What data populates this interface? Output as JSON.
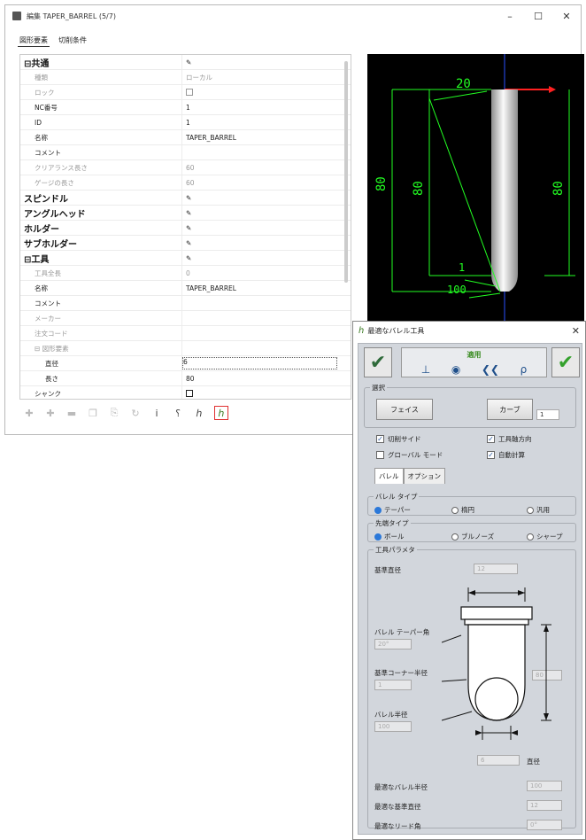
{
  "window": {
    "title": "編集 TAPER_BARREL (5/7)",
    "btn_min": "–",
    "btn_max": "☐",
    "btn_close": "✕"
  },
  "tabs": [
    "図形要素",
    "切削条件"
  ],
  "grid": {
    "rows": [
      {
        "key": "⊟共通",
        "val": "✎",
        "kind": "h"
      },
      {
        "key": "種類",
        "val": "ローカル",
        "kind": "sub"
      },
      {
        "key": "ロック",
        "val": "",
        "kind": "sub",
        "check": true
      },
      {
        "key": "NC番号",
        "val": "1",
        "kind": "dk"
      },
      {
        "key": "ID",
        "val": "1",
        "kind": "dk"
      },
      {
        "key": "名称",
        "val": "TAPER_BARREL",
        "kind": "dk"
      },
      {
        "key": "コメント",
        "val": "",
        "kind": "dk"
      },
      {
        "key": "クリアランス長さ",
        "val": "60",
        "kind": "sub"
      },
      {
        "key": "ゲージの長さ",
        "val": "60",
        "kind": "sub"
      },
      {
        "key": "スピンドル",
        "val": "✎",
        "kind": "h"
      },
      {
        "key": "アングルヘッド",
        "val": "✎",
        "kind": "h"
      },
      {
        "key": "ホルダー",
        "val": "✎",
        "kind": "h"
      },
      {
        "key": "サブホルダー",
        "val": "✎",
        "kind": "h"
      },
      {
        "key": "⊟工具",
        "val": "✎",
        "kind": "h"
      },
      {
        "key": "工具全長",
        "val": "0",
        "kind": "sub"
      },
      {
        "key": "名称",
        "val": "TAPER_BARREL",
        "kind": "dk"
      },
      {
        "key": "コメント",
        "val": "",
        "kind": "dk"
      },
      {
        "key": "メーカー",
        "val": "",
        "kind": "sub"
      },
      {
        "key": "注文コード",
        "val": "",
        "kind": "sub"
      },
      {
        "key": "⊟ 図形要素",
        "val": "",
        "kind": "sub"
      },
      {
        "key": "直径",
        "val": "6",
        "kind": "dk",
        "indent": true,
        "selected": true
      },
      {
        "key": "長さ",
        "val": "80",
        "kind": "dk",
        "indent": true
      },
      {
        "key": "シャンク",
        "val": "",
        "kind": "dk",
        "check": true
      }
    ]
  },
  "preview": {
    "dim_top": "20",
    "dim_left": "80",
    "dim_mid": "80",
    "dim_right": "80",
    "dim_1": "1",
    "dim_100": "100",
    "shank_color": "#e8e8e8",
    "dim_color": "#22ff22",
    "axis_x_color": "#ff2020",
    "axis_y_color": "#2a50ff"
  },
  "dialog": {
    "title": "最適なバレル工具",
    "apply_label": "適用",
    "select_group": "選択",
    "face_label": "フェイス",
    "curve_label": "カーブ",
    "curve_count": "1",
    "cb_cut_side": "切削サイド",
    "cb_tool_dir": "工具軸方向",
    "cb_global": "グローバル モード",
    "cb_auto_calc": "自動計算",
    "tab_barrel": "バレル",
    "tab_option": "オプション",
    "barrel_type_group": "バレル タイプ",
    "bt_taper": "テーパー",
    "bt_ellipse": "楕円",
    "bt_general": "汎用",
    "tip_type_group": "先端タイプ",
    "tt_ball": "ボール",
    "tt_bullnose": "ブルノーズ",
    "tt_sharp": "シャープ",
    "tool_param_group": "工具パラメタ",
    "base_dia_label": "基準直径",
    "base_dia_val": "12",
    "barrel_taper_label": "バレル テーパー角",
    "barrel_taper_val": "20°",
    "base_corner_label": "基準コーナー半径",
    "base_corner_val": "1",
    "barrel_radius_label": "バレル半径",
    "barrel_radius_val": "100",
    "length_val": "80",
    "diameter_val": "6",
    "diameter_label": "直径",
    "opt_barrel_radius_label": "最適なバレル半径",
    "opt_barrel_radius_val": "100",
    "opt_base_dia_label": "最適な基準直径",
    "opt_base_dia_val": "12",
    "opt_lead_label": "最適なリード角",
    "opt_lead_val": "0°"
  }
}
